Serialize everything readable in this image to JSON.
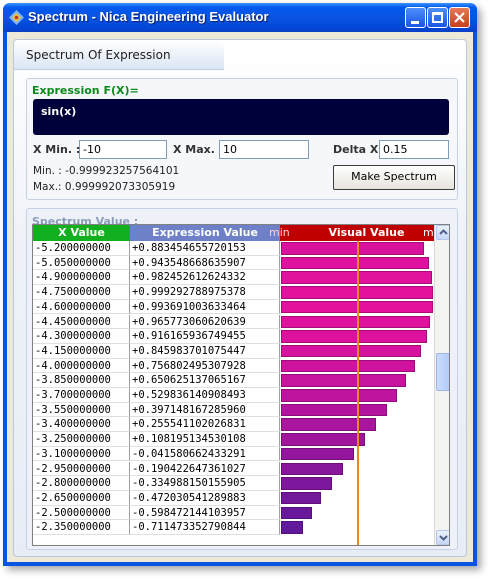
{
  "window": {
    "title": "Spectrum - Nica Engineering Evaluator"
  },
  "tab": {
    "label": "Spectrum Of Expression"
  },
  "expression": {
    "group_label": "Expression F(X)=",
    "value": "sin(x)",
    "xmin_label": "X Min. :",
    "xmin_value": "-10",
    "xmax_label": "X Max. :",
    "xmax_value": "10",
    "delta_label": "Delta X :",
    "delta_value": "0.15",
    "min_text": "Min. : -0.999923257564101",
    "max_text": "Max.: 0.999992073305919",
    "make_button": "Make Spectrum",
    "colors": {
      "label": "#0a8a1a",
      "box_bg": "#00003a"
    }
  },
  "spectrum": {
    "group_label": "Spectrum Value :",
    "headers": {
      "x": "X Value",
      "expr": "Expression Value",
      "visual": "Visual Value",
      "min": "min",
      "max": "max"
    },
    "rows": [
      {
        "x": "-5.200000000",
        "y": "+0.883454655720153",
        "v": 0.883454655720153
      },
      {
        "x": "-5.050000000",
        "y": "+0.943548668635907",
        "v": 0.943548668635907
      },
      {
        "x": "-4.900000000",
        "y": "+0.982452612624332",
        "v": 0.982452612624332
      },
      {
        "x": "-4.750000000",
        "y": "+0.999292788975378",
        "v": 0.999292788975378
      },
      {
        "x": "-4.600000000",
        "y": "+0.993691003633464",
        "v": 0.993691003633464
      },
      {
        "x": "-4.450000000",
        "y": "+0.965773060620639",
        "v": 0.965773060620639
      },
      {
        "x": "-4.300000000",
        "y": "+0.916165936749455",
        "v": 0.916165936749455
      },
      {
        "x": "-4.150000000",
        "y": "+0.845983701075447",
        "v": 0.845983701075447
      },
      {
        "x": "-4.000000000",
        "y": "+0.756802495307928",
        "v": 0.756802495307928
      },
      {
        "x": "-3.850000000",
        "y": "+0.650625137065167",
        "v": 0.650625137065167
      },
      {
        "x": "-3.700000000",
        "y": "+0.529836140908493",
        "v": 0.529836140908493
      },
      {
        "x": "-3.550000000",
        "y": "+0.397148167285960",
        "v": 0.39714816728596
      },
      {
        "x": "-3.400000000",
        "y": "+0.255541102026831",
        "v": 0.255541102026831
      },
      {
        "x": "-3.250000000",
        "y": "+0.108195134530108",
        "v": 0.108195134530108
      },
      {
        "x": "-3.100000000",
        "y": "-0.041580662433291",
        "v": -0.041580662433291
      },
      {
        "x": "-2.950000000",
        "y": "-0.190422647361027",
        "v": -0.190422647361027
      },
      {
        "x": "-2.800000000",
        "y": "-0.334988150155905",
        "v": -0.334988150155905
      },
      {
        "x": "-2.650000000",
        "y": "-0.472030541289883",
        "v": -0.472030541289883
      },
      {
        "x": "-2.500000000",
        "y": "-0.598472144103957",
        "v": -0.598472144103957
      },
      {
        "x": "-2.350000000",
        "y": "-0.711473352790844",
        "v": -0.711473352790844
      }
    ],
    "range": {
      "min": -0.999923257564101,
      "max": 0.999992073305919
    },
    "colors": {
      "x_header": "#12b01f",
      "expr_header": "#6d80c8",
      "visual_header": "#c00000",
      "bar_high": "#e2129e",
      "bar_low": "#4b1a9a",
      "zero_line": "#e88a1a"
    },
    "scroll": {
      "position": 0.45
    }
  }
}
